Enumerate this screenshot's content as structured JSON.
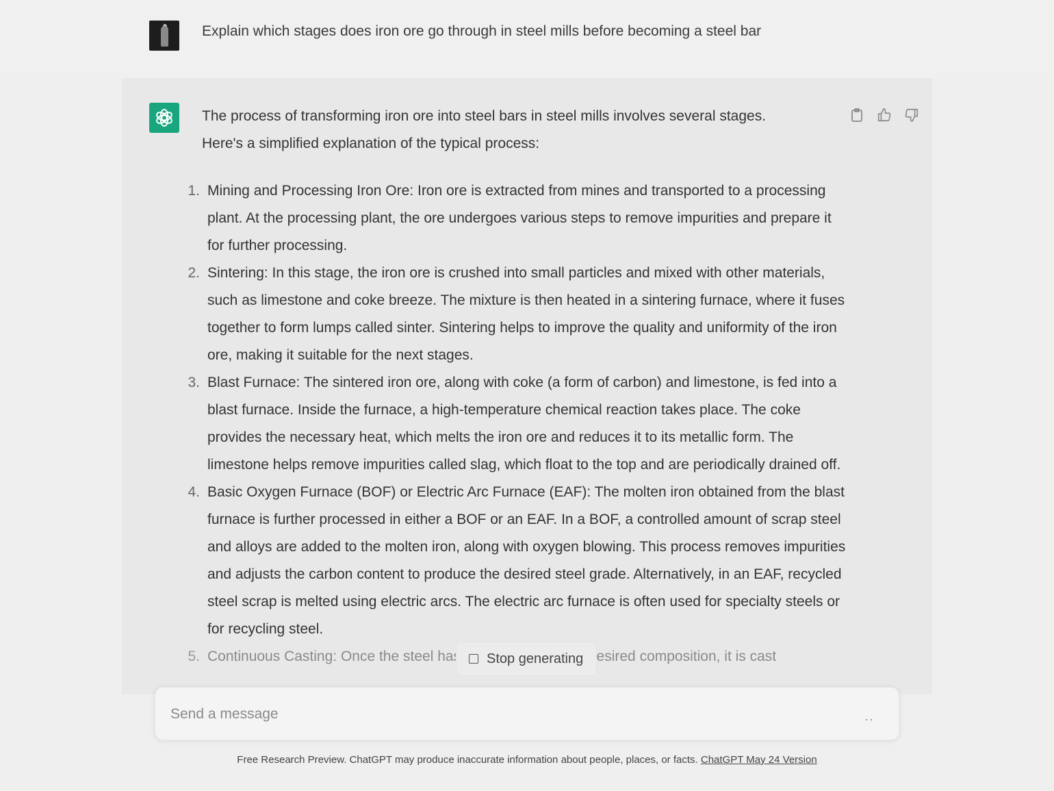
{
  "user": {
    "avatar_icon": "user-photo-avatar",
    "message": "Explain which stages does iron ore go through in steel mills before becoming a steel bar"
  },
  "assistant": {
    "avatar_icon": "chatgpt-logo",
    "accent_color": "#19a67e",
    "intro_line1": "The process of transforming iron ore into steel bars in steel mills involves several stages.",
    "intro_line2": "Here's a simplified explanation of the typical process:",
    "steps": [
      {
        "num": "1.",
        "text": "Mining and Processing Iron Ore: Iron ore is extracted from mines and transported to a processing plant. At the processing plant, the ore undergoes various steps to remove impurities and prepare it for further processing."
      },
      {
        "num": "2.",
        "text": "Sintering: In this stage, the iron ore is crushed into small particles and mixed with other materials, such as limestone and coke breeze. The mixture is then heated in a sintering furnace, where it fuses together to form lumps called sinter. Sintering helps to improve the quality and uniformity of the iron ore, making it suitable for the next stages."
      },
      {
        "num": "3.",
        "text": "Blast Furnace: The sintered iron ore, along with coke (a form of carbon) and limestone, is fed into a blast furnace. Inside the furnace, a high-temperature chemical reaction takes place. The coke provides the necessary heat, which melts the iron ore and reduces it to its metallic form. The limestone helps remove impurities called slag, which float to the top and are periodically drained off."
      },
      {
        "num": "4.",
        "text": "Basic Oxygen Furnace (BOF) or Electric Arc Furnace (EAF): The molten iron obtained from the blast furnace is further processed in either a BOF or an EAF. In a BOF, a controlled amount of scrap steel and alloys are added to the molten iron, along with oxygen blowing. This process removes impurities and adjusts the carbon content to produce the desired steel grade. Alternatively, in an EAF, recycled steel scrap is melted using electric arcs. The electric arc furnace is often used for specialty steels or for recycling steel."
      },
      {
        "num": "5.",
        "text": "Continuous Casting: Once the steel has been refined to the desired composition, it is cast"
      }
    ],
    "actions": [
      "clipboard-icon",
      "thumbs-up-icon",
      "thumbs-down-icon"
    ]
  },
  "stop_button": {
    "label": "Stop generating",
    "icon": "stop-square-icon"
  },
  "composer": {
    "placeholder": "Send a message",
    "indicator": "··"
  },
  "footer": {
    "text": "Free Research Preview. ChatGPT may produce inaccurate information about people, places, or facts. ",
    "link": "ChatGPT May 24 Version"
  }
}
